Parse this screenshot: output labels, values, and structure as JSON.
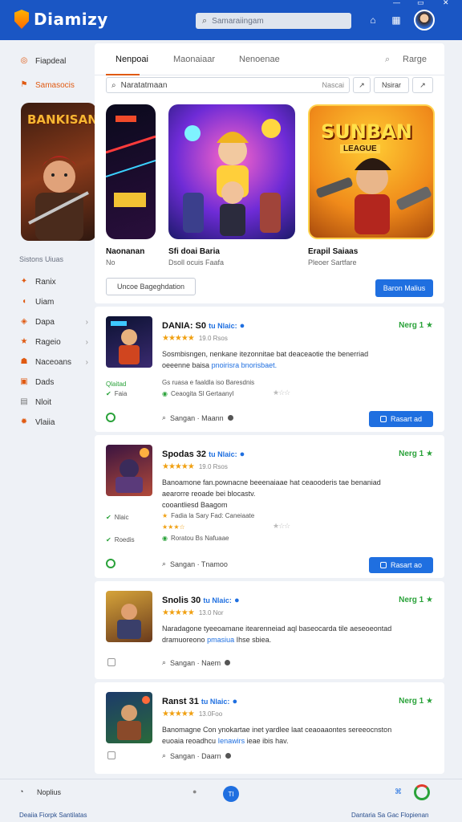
{
  "app": {
    "logo_text": "Diamizy"
  },
  "header": {
    "search_placeholder": "Samaraiingam",
    "icons": [
      "home-icon",
      "grid-icon",
      "avatar"
    ]
  },
  "sidebar": {
    "top_items": [
      {
        "label": "Fiapdeal",
        "icon": "target-icon"
      },
      {
        "label": "Samasocis",
        "icon": "flag-icon",
        "active": true
      }
    ],
    "section_heading": "Sistons Uiuas",
    "items": [
      {
        "label": "Ranix",
        "icon": "fire-icon"
      },
      {
        "label": "Uiam",
        "icon": "tag-icon"
      },
      {
        "label": "Dapa",
        "icon": "badge-icon",
        "chevron": true
      },
      {
        "label": "Rageio",
        "icon": "star-icon",
        "chevron": true
      },
      {
        "label": "Naceoans",
        "icon": "users-icon",
        "chevron": true
      },
      {
        "label": "Dads",
        "icon": "box-icon"
      },
      {
        "label": "Nloit",
        "icon": "doc-icon"
      },
      {
        "label": "Vlaiia",
        "icon": "sun-icon"
      }
    ],
    "feature_art_title": "BANKISAN"
  },
  "featured": {
    "tabs": [
      "Nenpoai",
      "Maonaiaar",
      "Nenoenae",
      "Rarge"
    ],
    "search_value": "Naratatmaan",
    "search_hint": "Nascai",
    "mini_buttons": [
      "Nsirar"
    ],
    "cards": [
      {
        "name": "Naonanan",
        "sub": "No",
        "art": "neon"
      },
      {
        "name": "Sfi doai Baria",
        "sub": "Dsoll ocuis Faafa",
        "art": "hero"
      },
      {
        "name": "Erapil Saiaas",
        "sub": "Pleoer Sartfare",
        "art_title": "SUNBAN",
        "art_sub": "LEAGUE",
        "art": "sunban"
      }
    ],
    "outline_button": "Uncoe Bageghdation",
    "primary_button": "Baron Malius"
  },
  "list": [
    {
      "title": "DANIA: S0",
      "tag": "tu Nlaic:",
      "stars": "★★★★★",
      "meta": "19.0 Rsos",
      "desc_a": "Sosmbisngen, nenkane itezonnitae bat deaceaotie the benerriad",
      "desc_b": "oeeenne baisa",
      "desc_hl": "pnoirisra bnorisbaet.",
      "badge": "Nerg 1",
      "left_meta_1": "Qlaitad",
      "left_meta_2": "Faia",
      "row_1": "Gs ruasa e faaldla  iso Baresdnis",
      "row_2": "Ceaogita  Sl Gertaanyl",
      "author": "Sangan · Maann",
      "install": "Rasart ad",
      "art": "a"
    },
    {
      "title": "Spodas 32",
      "tag": "tu Nlaic:",
      "stars": "★★★★★",
      "meta": "19.0 Rsos",
      "desc_a": "Banoamone fan.pownacne beeenaiaae hat ceaooderis tae benaniad",
      "desc_b": "aearorre reoade bei blocastv.",
      "desc_hl": "",
      "desc_c": "cooantliesd Baagom",
      "badge": "Nerg 1",
      "left_meta_1": "Nlaic",
      "left_meta_2": "Roedis",
      "row_1": "Fadia  la  Sary Fad:  Caneiaate",
      "row_2": "Roratou Bs Nafuaae",
      "author": "Sangan · Tnamoo",
      "install": "Rasart ao",
      "art": "b"
    },
    {
      "title": "Snolis 30",
      "tag": "tu Nlaic:",
      "stars": "★★★★★",
      "meta": "13.0 Nor",
      "desc_a": "Naradagone tyeeoamane itearenneiad aql baseocarda tile aeseoeontad",
      "desc_b": "dramuoreono",
      "desc_hl": "pmasiua",
      "desc_tail": "Ihse sbiea.",
      "badge": "Nerg 1",
      "author": "Sangan · Naem",
      "art": "c"
    },
    {
      "title": "Ranst 31",
      "tag": "tu Nlaic:",
      "stars": "★★★★★",
      "meta": "13.0Foo",
      "desc_a": "Banomagne Con ynokartae inet yardlee laat ceaoaaontes sereeocnston",
      "desc_b": "euoaia reoadhcu",
      "desc_hl": "Ienawirs",
      "desc_tail": "ieae ibis hav.",
      "badge": "Nerg 1",
      "author": "Sangan · Daarn",
      "art": "d"
    }
  ],
  "footer": {
    "left_label": "Noplius",
    "bottom_left": "Deaiia Fiorpk Santilatas",
    "bottom_right": "Dantaria Sa Gac Flopienan",
    "center_badge": "TI"
  }
}
